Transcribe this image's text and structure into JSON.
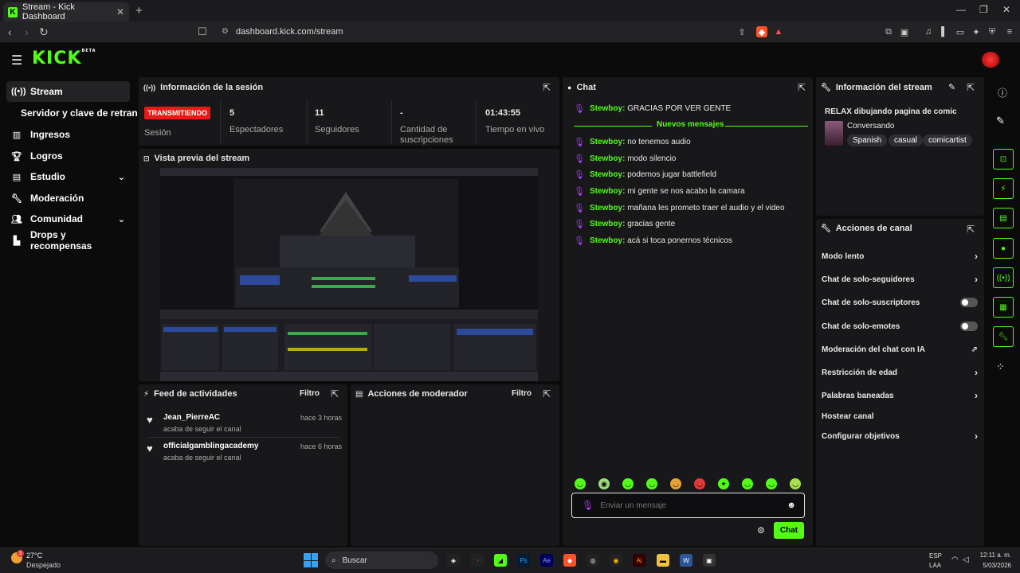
{
  "browser": {
    "tab_title": "Stream - Kick Dashboard",
    "url": "dashboard.kick.com/stream"
  },
  "app": {
    "logo": "KICK",
    "logo_badge": "BETA"
  },
  "sidebar": {
    "items": [
      {
        "label": "Stream",
        "icon": "broadcast-icon"
      },
      {
        "label": "Servidor y clave de retransm"
      },
      {
        "label": "Ingresos",
        "icon": "revenue-icon"
      },
      {
        "label": "Logros",
        "icon": "trophy-icon"
      },
      {
        "label": "Estudio",
        "icon": "studio-icon"
      },
      {
        "label": "Moderación",
        "icon": "wrench-icon"
      },
      {
        "label": "Comunidad",
        "icon": "community-icon"
      },
      {
        "label": "Drops y recompensas",
        "icon": "drops-icon"
      }
    ]
  },
  "session": {
    "title": "Información de la sesión",
    "live_badge": "TRANSMITIENDO",
    "session_label": "Sesión",
    "stats": [
      {
        "value": "5",
        "label": "Espectadores"
      },
      {
        "value": "11",
        "label": "Seguidores"
      },
      {
        "value": "-",
        "label": "Cantidad de suscripciones"
      },
      {
        "value": "01:43:55",
        "label": "Tiempo en vivo"
      }
    ]
  },
  "preview": {
    "title": "Vista previa del stream"
  },
  "activity": {
    "title": "Feed de actividades",
    "filter": "Filtro",
    "items": [
      {
        "name": "Jean_PierreAC",
        "time": "hace 3 horas",
        "action": "acaba de seguir el canal"
      },
      {
        "name": "officialgamblingacademy",
        "time": "hace 6 horas",
        "action": "acaba de seguir el canal"
      }
    ]
  },
  "modactions": {
    "title": "Acciones de moderador",
    "filter": "Filtro"
  },
  "chat": {
    "title": "Chat",
    "first": {
      "user": "Stewboy:",
      "text": "GRACIAS POR VER GENTE"
    },
    "new_messages": "Nuevos mensajes",
    "messages": [
      {
        "user": "Stewboy:",
        "text": "no tenemos audio"
      },
      {
        "user": "Stewboy:",
        "text": "modo silencio"
      },
      {
        "user": "Stewboy:",
        "text": "podemos jugar battlefield"
      },
      {
        "user": "Stewboy:",
        "text": "mi gente se nos acabo la camara"
      },
      {
        "user": "Stewboy:",
        "text": "mañana les prometo traer el audio y el video"
      },
      {
        "user": "Stewboy:",
        "text": "gracias gente"
      },
      {
        "user": "Stewboy:",
        "text": "acá si toca ponernos técnicos"
      }
    ],
    "placeholder": "Enviar un mensaje",
    "send": "Chat"
  },
  "stream_info": {
    "title": "Información del stream",
    "stream_title": "RELAX dibujando pagina de comic",
    "category": "Conversando",
    "tags": [
      "Spanish",
      "casual",
      "comicartist"
    ]
  },
  "channel_actions": {
    "title": "Acciones de canal",
    "items": [
      "Modo lento",
      "Chat de solo-seguidores",
      "Chat de solo-suscriptores",
      "Chat de solo-emotes",
      "Moderación del chat con IA",
      "Restricción de edad",
      "Palabras baneadas",
      "Hostear canal",
      "Configurar objetivos"
    ]
  },
  "taskbar": {
    "weather_temp": "27°C",
    "weather_desc": "Despejado",
    "search": "Buscar",
    "lang": "ESP",
    "lang2": "LAA",
    "time": "12:11 a. m.",
    "date": "5/03/2026",
    "notif_count": "3"
  },
  "colors": {
    "accent": "#53fc18",
    "live": "#e91916",
    "mic": "#b23cfd"
  }
}
